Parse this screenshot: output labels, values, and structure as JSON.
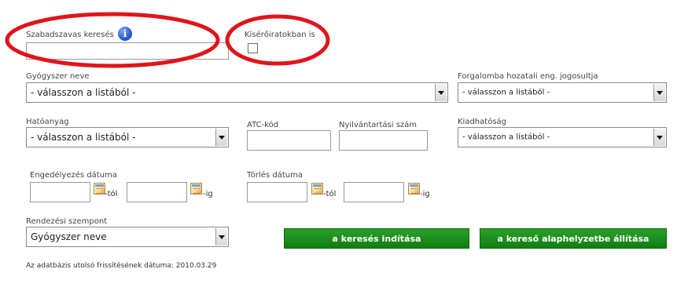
{
  "freetext": {
    "label": "Szabadszavas keresés",
    "value": ""
  },
  "attachments": {
    "label": "Kísérőiratokban is",
    "checked": false
  },
  "drug_name": {
    "label": "Gyógyszer neve",
    "value": "- válasszon a listából -"
  },
  "license_holder": {
    "label": "Forgalomba hozatali eng. jogosultja",
    "value": "- válasszon a listából -"
  },
  "active_ingredient": {
    "label": "Hatóanyag",
    "value": "- válasszon a listából -"
  },
  "atc": {
    "label": "ATC-kód",
    "value": ""
  },
  "registration": {
    "label": "Nyilvántartási szám",
    "value": ""
  },
  "dispensing": {
    "label": "Kiadhatóság",
    "value": "- válasszon a listából -"
  },
  "approval_date": {
    "label": "Engedélyezés dátuma",
    "from_suffix": "-tól",
    "to_suffix": "-ig"
  },
  "deletion_date": {
    "label": "Törlés dátuma",
    "from_suffix": "-tól",
    "to_suffix": "-ig"
  },
  "sort": {
    "label": "Rendezési szempont",
    "value": "Gyógyszer neve"
  },
  "buttons": {
    "search": "a keresés indítása",
    "reset": "a kereső alaphelyzetbe állítása"
  },
  "footer": {
    "last_update": "Az adatbázis utolsó frissítésének dátuma: 2010.03.29"
  },
  "colors": {
    "button_green": "#1a8c1a",
    "highlight_circle": "#e0141b",
    "info_blue": "#1d4fc6"
  }
}
